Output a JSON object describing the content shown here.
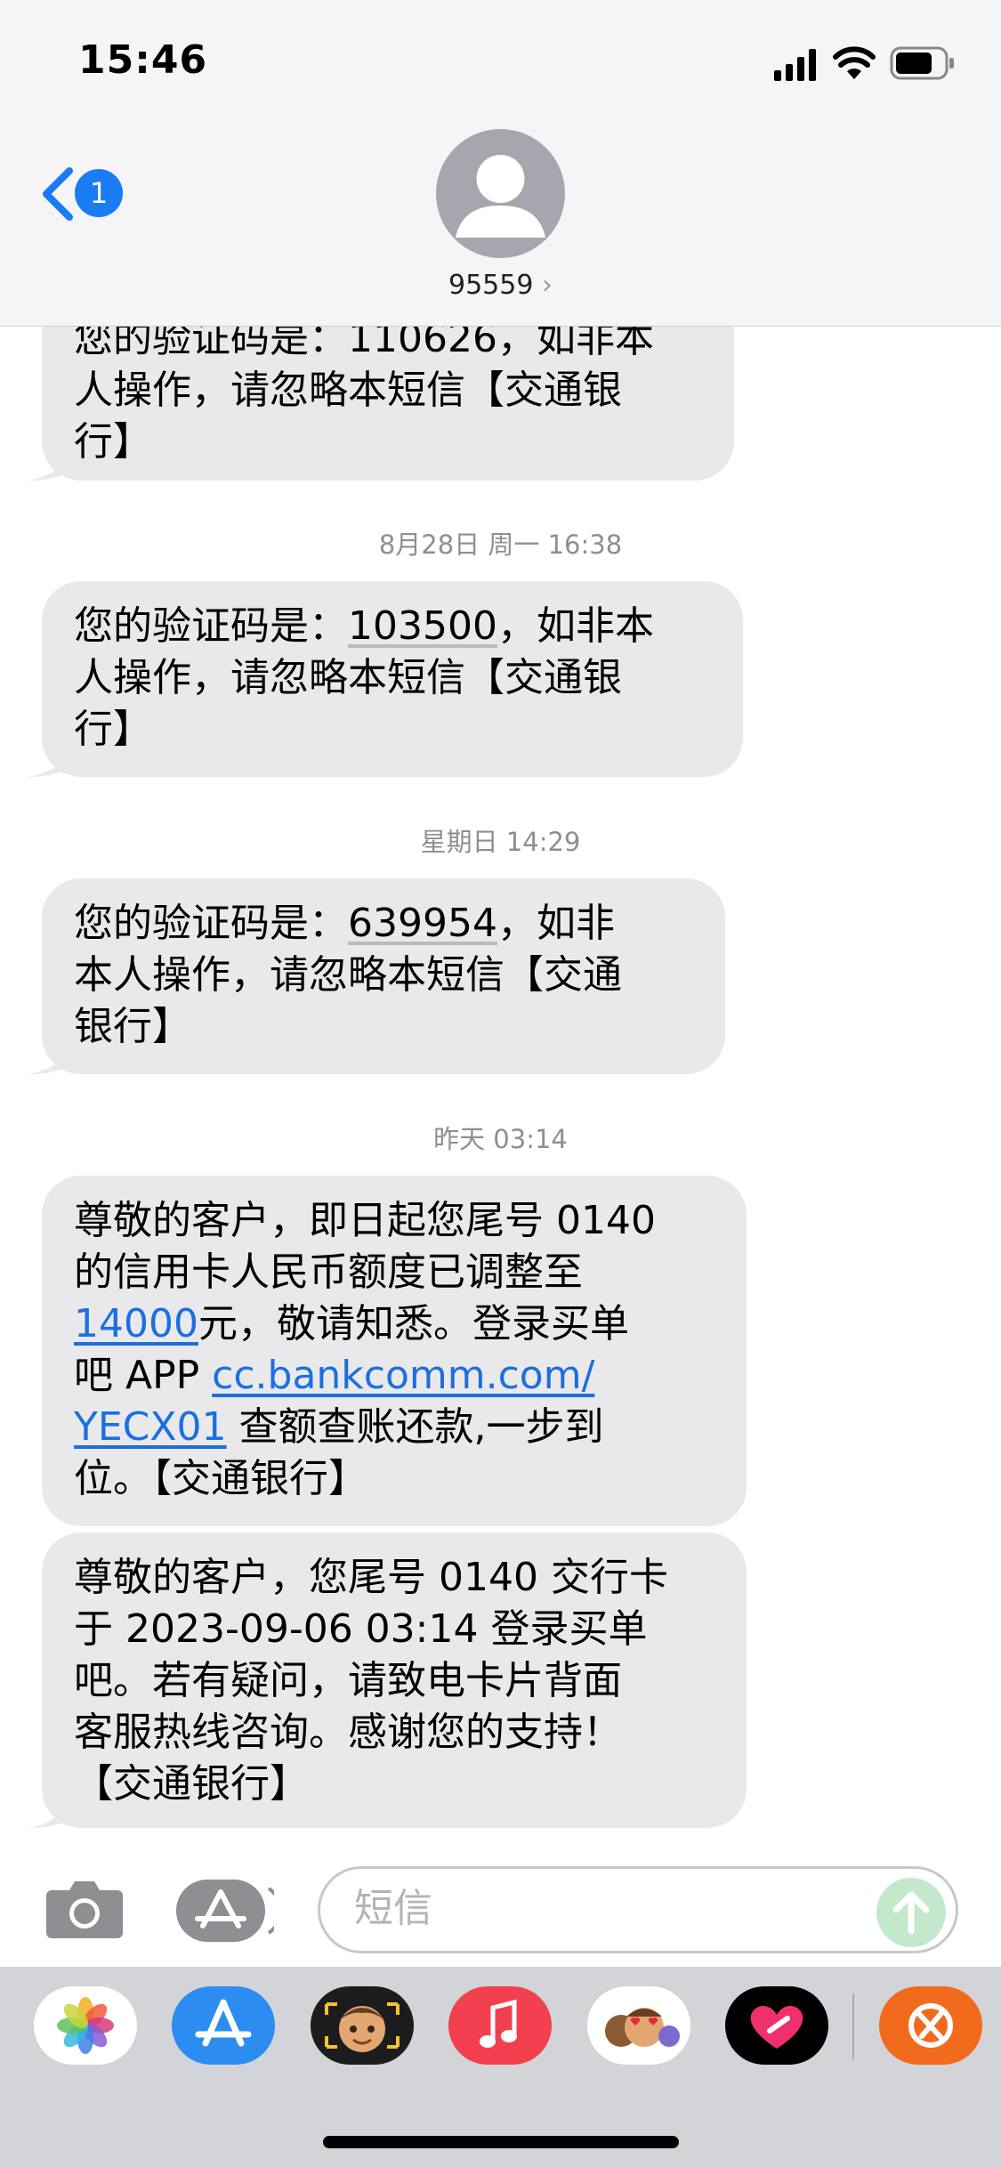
{
  "status_bar": {
    "time": "15:46"
  },
  "header": {
    "back_badge": "1",
    "contact_name": "95559",
    "chevron": "›"
  },
  "messages": [
    {
      "partial_top": "您的验证码是：110626，如非本",
      "lines": [
        "人操作，请忽略本短信【交通银",
        "行】"
      ]
    },
    {
      "timestamp": "8月28日 周一 16:38",
      "prefix": "您的验证码是：",
      "code": "103500",
      "suffix": "，如非本",
      "lines": [
        "人操作，请忽略本短信【交通银",
        "行】"
      ]
    },
    {
      "timestamp": "星期日 14:29",
      "prefix": "您的验证码是：",
      "code": "639954",
      "suffix": "，如非",
      "lines": [
        "本人操作，请忽略本短信【交通",
        "银行】"
      ]
    },
    {
      "timestamp": "昨天 03:14",
      "line1": "尊敬的客户，即日起您尾号 0140",
      "line2": "的信用卡人民币额度已调整至",
      "amount": "14000",
      "line3_rest": "元，敬请知悉。登录买单",
      "line4_pre": "吧 APP ",
      "link_part1": "cc.bankcomm.com/",
      "link_part2": "YECX01",
      "line5_rest": " 查额查账还款,一步到",
      "line6": "位。【交通银行】"
    },
    {
      "lines": [
        "尊敬的客户，您尾号 0140 交行卡",
        "于 2023-09-06 03:14 登录买单",
        "吧。若有疑问，请致电卡片背面",
        "客服热线咨询。感谢您的支持！",
        "【交通银行】"
      ]
    }
  ],
  "compose": {
    "placeholder": "短信"
  },
  "dock": {
    "apps": [
      "photos-icon",
      "app-store-icon",
      "memoji-icon",
      "music-icon",
      "memoji-stickers-icon",
      "heart-app-icon",
      "orange-app-icon"
    ]
  },
  "colors": {
    "bubble": "#e9e9eb",
    "link": "#1b6fe0",
    "ios_blue": "#1a7cf5",
    "header_bg": "#f5f5f7",
    "dock_bg": "#d3d4d8"
  }
}
